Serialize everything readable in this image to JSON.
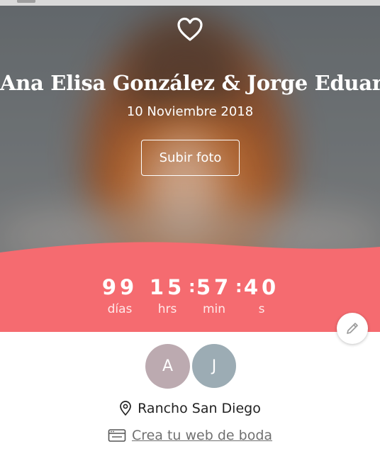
{
  "hero": {
    "names": "Ana Elisa González & Jorge Eduardo",
    "date": "10 Noviembre 2018",
    "upload_label": "Subir foto",
    "icon": "heart-outline-icon"
  },
  "countdown": {
    "units": [
      {
        "value": "99",
        "label": "días"
      },
      {
        "value": "15",
        "label": "hrs"
      },
      {
        "value": "57",
        "label": "min"
      },
      {
        "value": "40",
        "label": "s"
      }
    ],
    "accent_color": "#f56b70"
  },
  "profile": {
    "avatars": [
      {
        "initial": "A",
        "color": "#bcaab0"
      },
      {
        "initial": "J",
        "color": "#9cacb4"
      }
    ],
    "location": "Rancho San Diego",
    "create_web_link": "Crea tu web de boda"
  },
  "icons": {
    "edit": "pencil-icon",
    "location": "map-pin-icon",
    "web": "browser-window-icon"
  }
}
